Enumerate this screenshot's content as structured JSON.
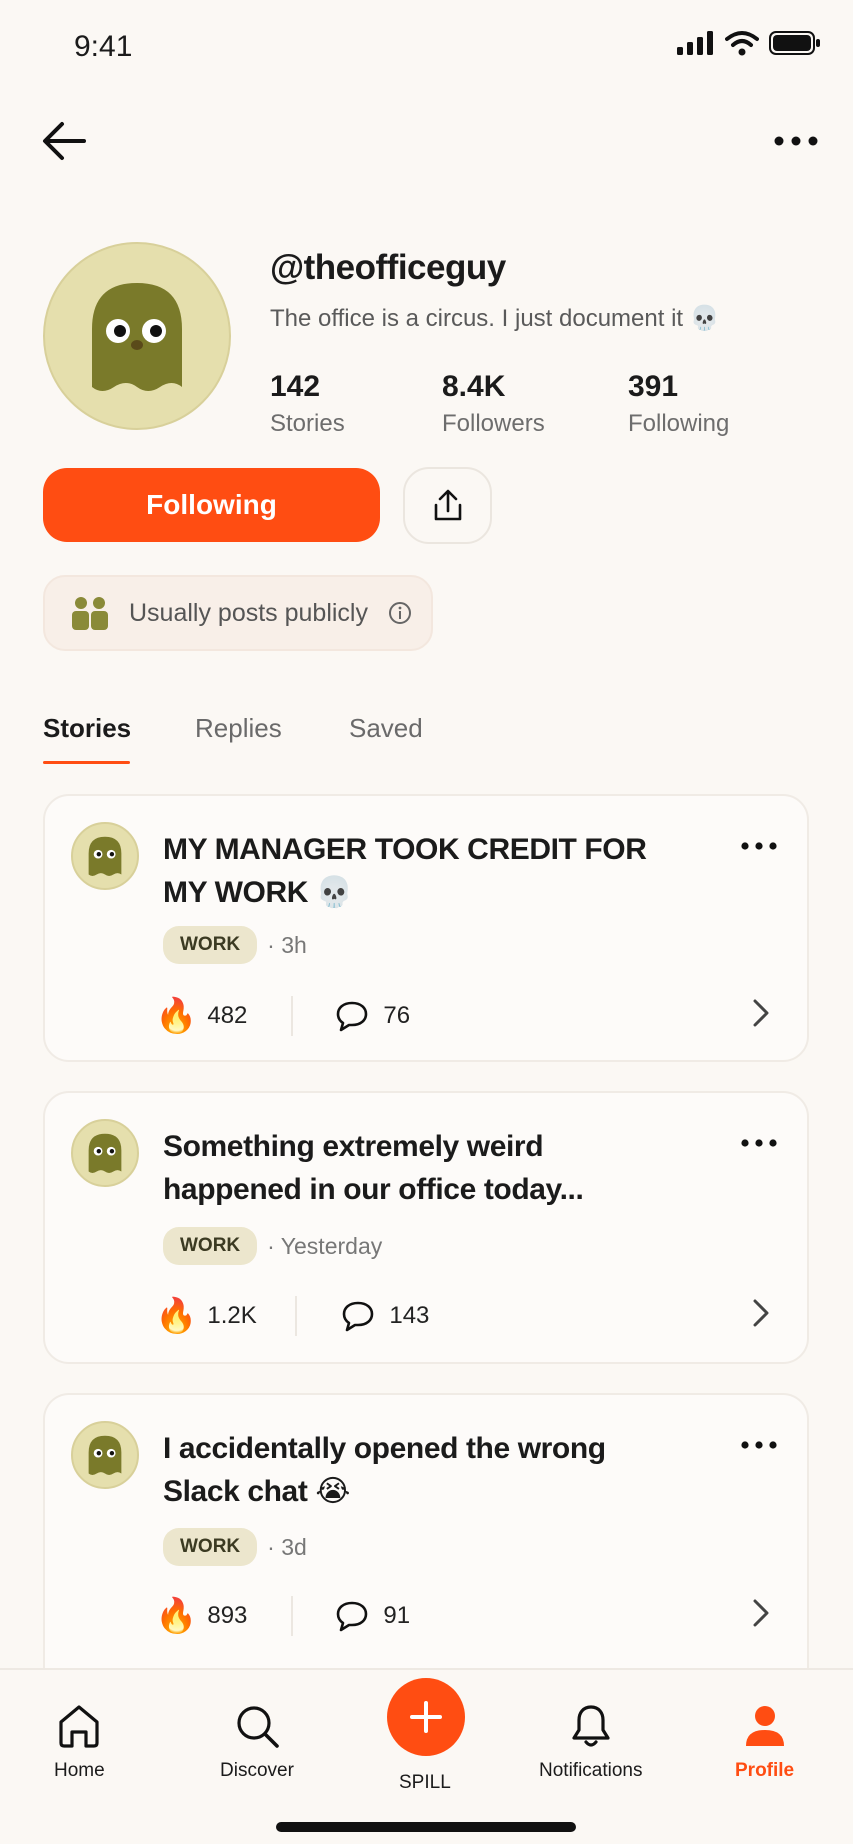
{
  "status": {
    "time": "9:41"
  },
  "profile": {
    "handle": "@theofficeguy",
    "bio": "The office is a circus. I just document it 💀",
    "stats": [
      {
        "value": "142",
        "label": "Stories"
      },
      {
        "value": "8.4K",
        "label": "Followers"
      },
      {
        "value": "391",
        "label": "Following"
      }
    ],
    "follow_label": "Following",
    "privacy_text": "Usually posts publicly"
  },
  "tabs": [
    {
      "label": "Stories",
      "active": true
    },
    {
      "label": "Replies",
      "active": false
    },
    {
      "label": "Saved",
      "active": false
    }
  ],
  "stories": [
    {
      "title": "MY MANAGER TOOK CREDIT FOR MY WORK 💀",
      "tag": "WORK",
      "time": "· 3h",
      "reactions": "482",
      "comments": "76"
    },
    {
      "title": "Something extremely weird happened in our office today...",
      "tag": "WORK",
      "time": "· Yesterday",
      "reactions": "1.2K",
      "comments": "143"
    },
    {
      "title": "I accidentally opened the wrong Slack chat 😭",
      "tag": "WORK",
      "time": "· 3d",
      "reactions": "893",
      "comments": "91"
    }
  ],
  "nav": [
    {
      "label": "Home",
      "icon": "home-icon"
    },
    {
      "label": "Discover",
      "icon": "search-icon"
    },
    {
      "label": "SPILL",
      "icon": "plus-icon"
    },
    {
      "label": "Notifications",
      "icon": "bell-icon"
    },
    {
      "label": "Profile",
      "icon": "person-icon",
      "active": true
    }
  ],
  "colors": {
    "accent": "#ff4d12",
    "avatar_bg": "#e5dfad",
    "ghost": "#7a7a2a",
    "tag_bg": "#ece6cd",
    "background": "#fbf8f4"
  }
}
